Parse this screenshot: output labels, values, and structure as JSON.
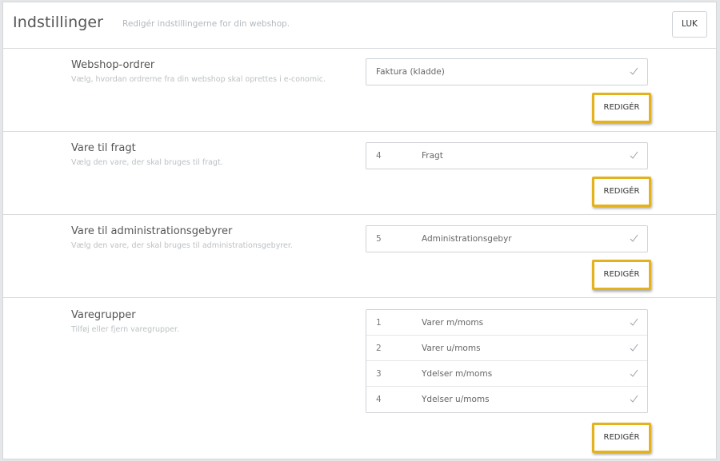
{
  "header": {
    "title": "Indstillinger",
    "subtitle": "Redigér indstillingerne for din webshop.",
    "close_label": "LUK"
  },
  "sections": [
    {
      "title": "Webshop-ordrer",
      "description": "Vælg, hvordan ordrerne fra din webshop skal oprettes i e-conomic.",
      "value": "Faktura (kladde)",
      "edit_label": "REDIGÉR"
    },
    {
      "title": "Vare til fragt",
      "description": "Vælg den vare, der skal bruges til fragt.",
      "rows": [
        {
          "number": "4",
          "name": "Fragt"
        }
      ],
      "edit_label": "REDIGÉR"
    },
    {
      "title": "Vare til administrationsgebyrer",
      "description": "Vælg den vare, der skal bruges til administrationsgebyrer.",
      "rows": [
        {
          "number": "5",
          "name": "Administrationsgebyr"
        }
      ],
      "edit_label": "REDIGÉR"
    },
    {
      "title": "Varegrupper",
      "description": "Tilføj eller fjern varegrupper.",
      "rows": [
        {
          "number": "1",
          "name": "Varer m/moms"
        },
        {
          "number": "2",
          "name": "Varer u/moms"
        },
        {
          "number": "3",
          "name": "Ydelser m/moms"
        },
        {
          "number": "4",
          "name": "Ydelser u/moms"
        }
      ],
      "edit_label": "REDIGÉR"
    }
  ],
  "colors": {
    "highlight_border": "#e3b21d",
    "check_icon": "#9aa0a6"
  },
  "icons": {
    "row_check": "check-icon"
  }
}
